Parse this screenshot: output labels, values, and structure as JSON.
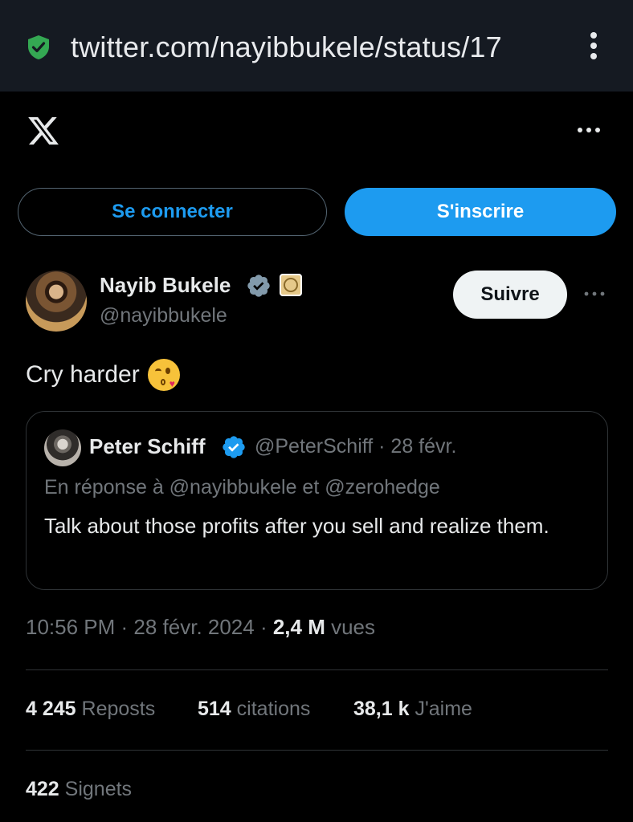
{
  "browser": {
    "url": "twitter.com/nayibbukele/status/17",
    "lock_icon": "shield-check-icon",
    "menu_icon": "kebab-menu-icon"
  },
  "header": {
    "logo_icon": "x-logo-icon",
    "more_icon": "more-horizontal-icon"
  },
  "auth": {
    "login_label": "Se connecter",
    "signup_label": "S'inscrire"
  },
  "author": {
    "name": "Nayib Bukele",
    "handle": "@nayibbukele",
    "follow_label": "Suivre"
  },
  "tweet": {
    "text": "Cry harder",
    "emoji": "😘"
  },
  "quote": {
    "name": "Peter Schiff",
    "handle_date": "@PeterSchiff · 28 févr.",
    "reply_to": "En réponse à @nayibbukele  et  @zerohedge",
    "text": "Talk about those profits after you sell and realize them."
  },
  "meta": {
    "timestamp": "10:56 PM · 28 févr. 2024 · ",
    "views_count": "2,4 M",
    "views_label": " vues"
  },
  "stats": {
    "reposts_count": "4 245",
    "reposts_label": " Reposts",
    "quotes_count": "514",
    "quotes_label": " citations",
    "likes_count": "38,1 k",
    "likes_label": " J'aime",
    "bookmarks_count": "422",
    "bookmarks_label": " Signets"
  },
  "colors": {
    "accent": "#1d9bf0",
    "background": "#000000",
    "muted": "#71767b",
    "border": "#2f3336"
  }
}
